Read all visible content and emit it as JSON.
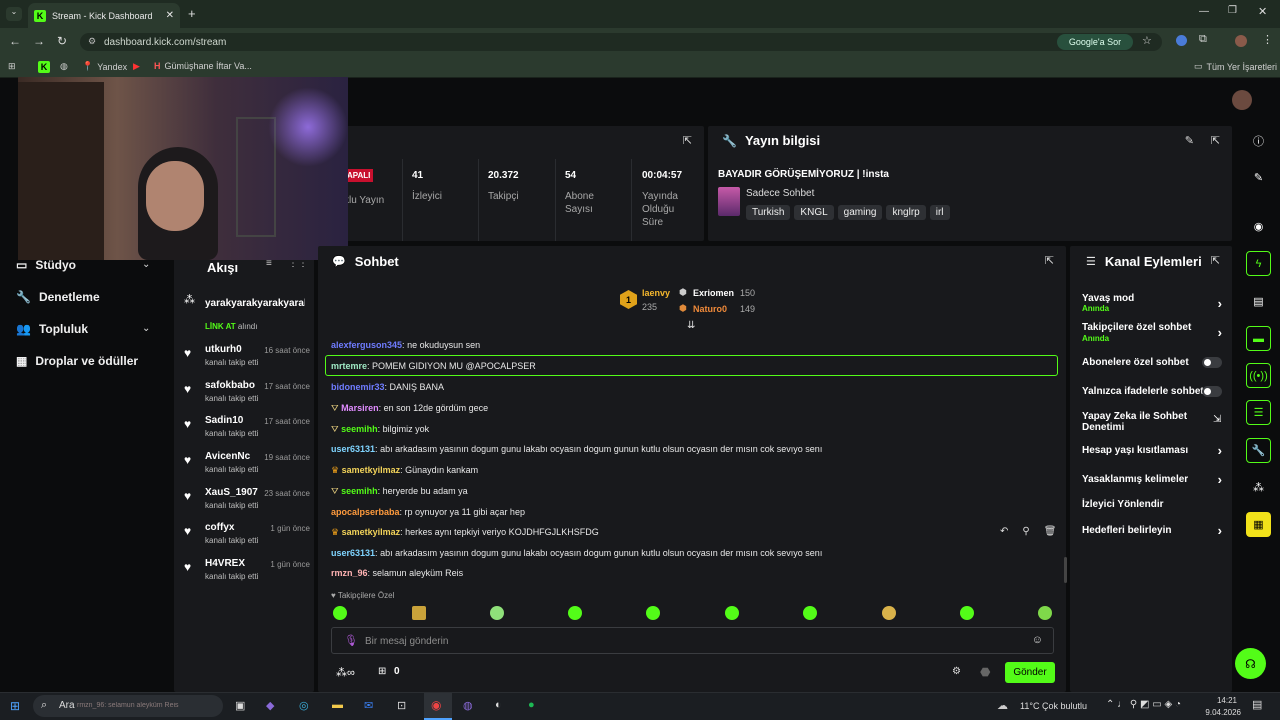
{
  "browser": {
    "tab_title": "Stream - Kick Dashboard",
    "url": "dashboard.kick.com/stream",
    "google_button": "Google'a Sor",
    "bookmarks": [
      "Yandex",
      "Gümüşhane İftar Va..."
    ],
    "all_bookmarks": "Tüm Yer İşaretleri"
  },
  "nav": {
    "items": [
      {
        "label": "Stüdyo",
        "has_chevron": true
      },
      {
        "label": "Denetleme",
        "has_chevron": false
      },
      {
        "label": "Topluluk",
        "has_chevron": true
      },
      {
        "label": "Droplar ve ödüller",
        "has_chevron": false
      }
    ]
  },
  "stats": {
    "status_badge": "APALI",
    "status_label": "klu Yayın",
    "items": [
      {
        "value": "41",
        "label": "İzleyici"
      },
      {
        "value": "20.372",
        "label": "Takipçi"
      },
      {
        "value": "54",
        "label": "Abone Sayısı"
      },
      {
        "value": "00:04:57",
        "label": "Yayında Olduğu Süre"
      }
    ]
  },
  "stream_info": {
    "title": "Yayın bilgisi",
    "stream_title": "BAYADIR GÖRÜŞEMİYORUZ | !insta",
    "category": "Sadece Sohbet",
    "tags": [
      "Turkish",
      "KNGL",
      "gaming",
      "knglrp",
      "irl"
    ]
  },
  "activity": {
    "title": "Akışı",
    "top_user": "yarakyarakyarakyarak",
    "top_action_highlight": "LİNK AT",
    "top_action_rest": "alındı",
    "follows": [
      {
        "name": "utkurh0",
        "time": "16 saat önce",
        "action": "kanalı takip etti"
      },
      {
        "name": "safokbabo",
        "time": "17 saat önce",
        "action": "kanalı takip etti"
      },
      {
        "name": "Sadin10",
        "time": "17 saat önce",
        "action": "kanalı takip etti"
      },
      {
        "name": "AvicenNc",
        "time": "19 saat önce",
        "action": "kanalı takip etti"
      },
      {
        "name": "XauS_1907",
        "time": "23 saat önce",
        "action": "kanalı takip etti"
      },
      {
        "name": "coffyx",
        "time": "1 gün önce",
        "action": "kanalı takip etti"
      },
      {
        "name": "H4VREX",
        "time": "1 gün önce",
        "action": "kanalı takip etti"
      }
    ]
  },
  "chat": {
    "title": "Sohbet",
    "leaderboard": {
      "first": {
        "name": "laenvy",
        "points": "235"
      },
      "second": {
        "name": "Exriomen",
        "points": "150"
      },
      "third": {
        "name": "Naturo0",
        "points": "149"
      }
    },
    "messages": [
      {
        "user": "alexferguson345",
        "color": "#6f7cff",
        "text": "ne okuduysun sen",
        "badge": ""
      },
      {
        "user": "mrtemre",
        "color": "#9fe8c4",
        "text": "POMEM GIDIYON MU @APOCALPSER",
        "badge": "",
        "highlight": true
      },
      {
        "user": "bidonemir33",
        "color": "#6f7cff",
        "text": "DANIŞ BANA",
        "badge": ""
      },
      {
        "user": "Marsiren",
        "color": "#e08cff",
        "text": "en son 12de gördüm gece",
        "badge": "og"
      },
      {
        "user": "seemihh",
        "color": "#53fc18",
        "text": "bilgimiz yok",
        "badge": "og"
      },
      {
        "user": "user63131",
        "color": "#7fd4ff",
        "text": "abı arkadasım yasının dogum gunu lakabı ocyasın dogum gunun kutlu olsun ocyasın der mısın cok sevıyo senı",
        "badge": ""
      },
      {
        "user": "sametkyilmaz",
        "color": "#f2d35a",
        "text": "Günaydın kankam",
        "badge": "crown"
      },
      {
        "user": "seemihh",
        "color": "#53fc18",
        "text": "heryerde bu adam ya",
        "badge": "og"
      },
      {
        "user": "apocalpserbaba",
        "color": "#ff9b3d",
        "text": "rp oynuyor ya 11 gibi açar hep",
        "badge": ""
      },
      {
        "user": "sametkyilmaz",
        "color": "#f2d35a",
        "text": "herkes aynı tepkiyi veriyo KOJDHFGJLKHSFDG",
        "badge": "crown"
      },
      {
        "user": "user63131",
        "color": "#7fd4ff",
        "text": "abı arkadasım yasının dogum gunu lakabı ocyasın dogum gunun kutlu olsun ocyasın der mısın cok sevıyo senı",
        "badge": ""
      },
      {
        "user": "rmzn_96",
        "color": "#ffb3b3",
        "text": "selamun aleyküm Reis",
        "badge": ""
      }
    ],
    "emote_section": "Takipçilere Özel",
    "input_placeholder": "Bir mesaj gönderin",
    "points": "0",
    "send_button": "Gönder"
  },
  "actions": {
    "title": "Kanal Eylemleri",
    "items": [
      {
        "label": "Yavaş mod",
        "sub": "Anında",
        "control": "arrow"
      },
      {
        "label": "Takipçilere özel sohbet",
        "sub": "Anında",
        "control": "arrow"
      },
      {
        "label": "Abonelere özel sohbet",
        "sub": "",
        "control": "toggle"
      },
      {
        "label": "Yalnızca ifadelerle sohbet",
        "sub": "",
        "control": "toggle"
      },
      {
        "label": "Yapay Zeka ile Sohbet Denetimi",
        "sub": "",
        "control": "external"
      },
      {
        "label": "Hesap yaşı kısıtlaması",
        "sub": "",
        "control": "arrow"
      },
      {
        "label": "Yasaklanmış kelimeler",
        "sub": "",
        "control": "arrow"
      },
      {
        "label": "İzleyici Yönlendir",
        "sub": "",
        "control": "none"
      },
      {
        "label": "Hedefleri belirleyin",
        "sub": "",
        "control": "arrow"
      }
    ]
  },
  "taskbar": {
    "search": "Ara",
    "search_overlay": "rmzn_96: selamun aleyküm Reis",
    "weather": "11°C  Çok bulutlu",
    "time": "14:21",
    "date": "9.04.2026"
  },
  "colors": {
    "brand": "#53fc18",
    "panel": "#18191c",
    "bg": "#0b0c0d"
  }
}
